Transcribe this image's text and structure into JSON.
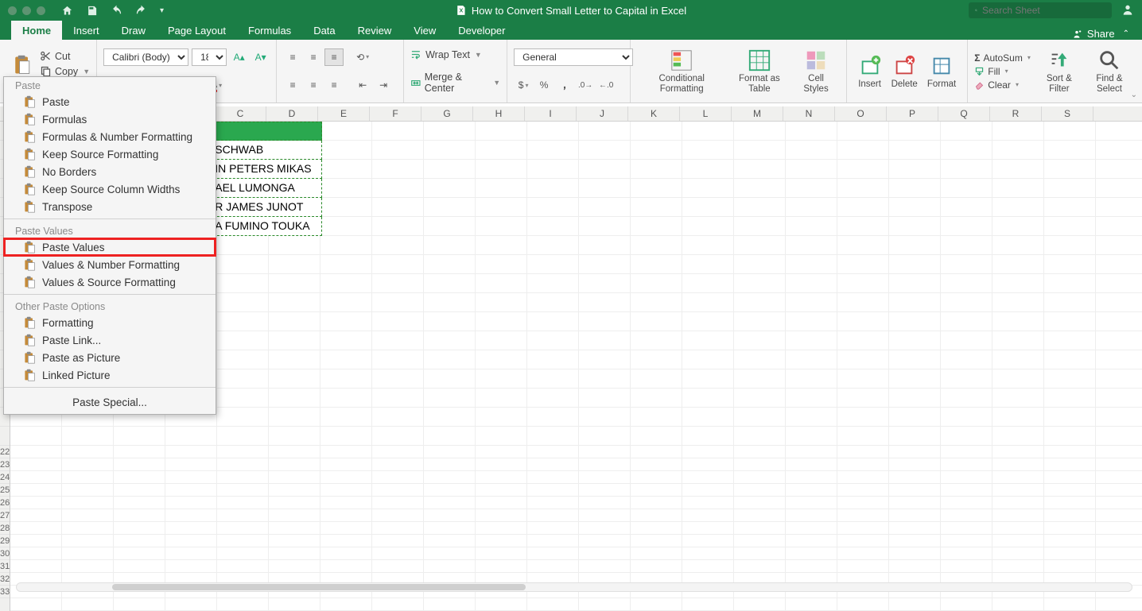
{
  "title": "How to Convert Small Letter to Capital in Excel",
  "search_placeholder": "Search Sheet",
  "share_label": "Share",
  "tabs": [
    "Home",
    "Insert",
    "Draw",
    "Page Layout",
    "Formulas",
    "Data",
    "Review",
    "View",
    "Developer"
  ],
  "clipboard": {
    "cut": "Cut",
    "copy": "Copy"
  },
  "font": {
    "name": "Calibri (Body)",
    "size": "18"
  },
  "alignment": {
    "wrap": "Wrap Text",
    "merge": "Merge & Center"
  },
  "number_format": "General",
  "styles": {
    "cond": "Conditional Formatting",
    "table": "Format as Table",
    "cell": "Cell Styles"
  },
  "cells_group": {
    "insert": "Insert",
    "delete": "Delete",
    "format": "Format"
  },
  "editing": {
    "autosum": "AutoSum",
    "fill": "Fill",
    "clear": "Clear"
  },
  "sortfilter": "Sort & Filter",
  "findselect": "Find & Select",
  "columns": [
    "C",
    "D",
    "E",
    "F",
    "G",
    "H",
    "I",
    "J",
    "K",
    "L",
    "M",
    "N",
    "O",
    "P",
    "Q",
    "R",
    "S"
  ],
  "row_numbers": [
    "22",
    "23",
    "24",
    "25",
    "26",
    "27",
    "28",
    "29",
    "30",
    "31",
    "32",
    "33"
  ],
  "data_rows": [
    "",
    "SCHWAB",
    "IN PETERS MIKAS",
    "AEL LUMONGA",
    "R JAMES JUNOT",
    "A FUMINO TOUKA"
  ],
  "dropdown": {
    "section1": "Paste",
    "items1": [
      "Paste",
      "Formulas",
      "Formulas & Number Formatting",
      "Keep Source Formatting",
      "No Borders",
      "Keep Source Column Widths",
      "Transpose"
    ],
    "section2": "Paste Values",
    "items2": [
      "Paste Values",
      "Values & Number Formatting",
      "Values & Source Formatting"
    ],
    "section3": "Other Paste Options",
    "items3": [
      "Formatting",
      "Paste Link...",
      "Paste as Picture",
      "Linked Picture"
    ],
    "special": "Paste Special..."
  }
}
